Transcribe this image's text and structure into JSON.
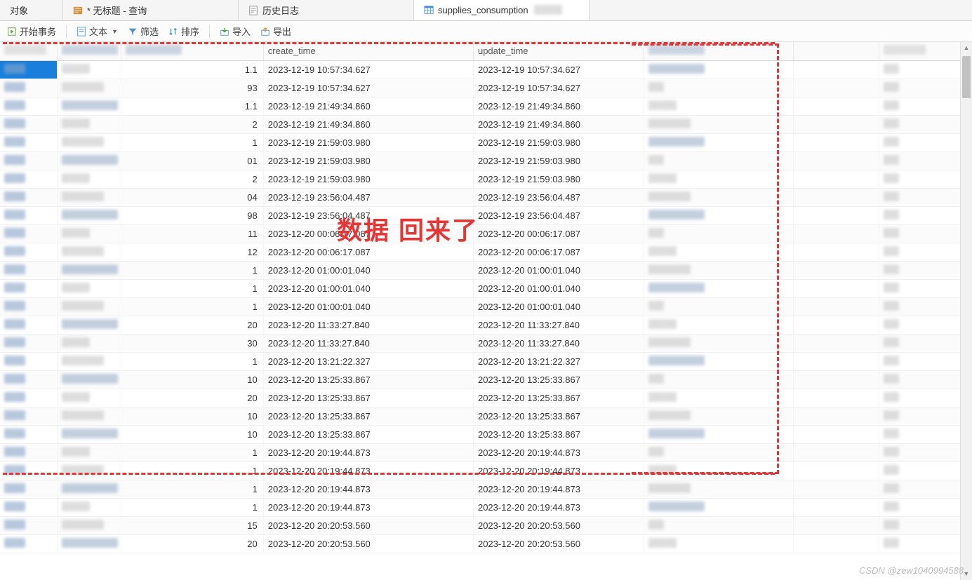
{
  "tabs": [
    {
      "label": "对象",
      "icon": "object"
    },
    {
      "label": "* 无标题 - 查询",
      "icon": "query"
    },
    {
      "label": "历史日志",
      "icon": "log"
    },
    {
      "label": "supplies_consumption",
      "icon": "table",
      "active": true
    }
  ],
  "toolbar": {
    "begin_tx": "开始事务",
    "text": "文本",
    "filter": "筛选",
    "sort": "排序",
    "import": "导入",
    "export": "导出"
  },
  "columns": {
    "c0": "",
    "c1": "",
    "c2": "",
    "create_time": "create_time",
    "update_time": "update_time",
    "c5": "",
    "c6": ""
  },
  "rows": [
    {
      "v": "1.1",
      "create": "2023-12-19 10:57:34.627",
      "update": "2023-12-19 10:57:34.627",
      "sel": true
    },
    {
      "v": "93",
      "create": "2023-12-19 10:57:34.627",
      "update": "2023-12-19 10:57:34.627"
    },
    {
      "v": "1.1",
      "create": "2023-12-19 21:49:34.860",
      "update": "2023-12-19 21:49:34.860"
    },
    {
      "v": "2",
      "create": "2023-12-19 21:49:34.860",
      "update": "2023-12-19 21:49:34.860"
    },
    {
      "v": "1",
      "create": "2023-12-19 21:59:03.980",
      "update": "2023-12-19 21:59:03.980"
    },
    {
      "v": "01",
      "create": "2023-12-19 21:59:03.980",
      "update": "2023-12-19 21:59:03.980"
    },
    {
      "v": "2",
      "create": "2023-12-19 21:59:03.980",
      "update": "2023-12-19 21:59:03.980"
    },
    {
      "v": "04",
      "create": "2023-12-19 23:56:04.487",
      "update": "2023-12-19 23:56:04.487"
    },
    {
      "v": "98",
      "create": "2023-12-19 23:56:04.487",
      "update": "2023-12-19 23:56:04.487"
    },
    {
      "v": "11",
      "create": "2023-12-20 00:06:17.087",
      "update": "2023-12-20 00:06:17.087"
    },
    {
      "v": "12",
      "create": "2023-12-20 00:06:17.087",
      "update": "2023-12-20 00:06:17.087"
    },
    {
      "v": "1",
      "create": "2023-12-20 01:00:01.040",
      "update": "2023-12-20 01:00:01.040"
    },
    {
      "v": "1",
      "create": "2023-12-20 01:00:01.040",
      "update": "2023-12-20 01:00:01.040"
    },
    {
      "v": "1",
      "create": "2023-12-20 01:00:01.040",
      "update": "2023-12-20 01:00:01.040"
    },
    {
      "v": "20",
      "create": "2023-12-20 11:33:27.840",
      "update": "2023-12-20 11:33:27.840"
    },
    {
      "v": "30",
      "create": "2023-12-20 11:33:27.840",
      "update": "2023-12-20 11:33:27.840"
    },
    {
      "v": "1",
      "create": "2023-12-20 13:21:22.327",
      "update": "2023-12-20 13:21:22.327"
    },
    {
      "v": "10",
      "create": "2023-12-20 13:25:33.867",
      "update": "2023-12-20 13:25:33.867"
    },
    {
      "v": "20",
      "create": "2023-12-20 13:25:33.867",
      "update": "2023-12-20 13:25:33.867"
    },
    {
      "v": "10",
      "create": "2023-12-20 13:25:33.867",
      "update": "2023-12-20 13:25:33.867"
    },
    {
      "v": "10",
      "create": "2023-12-20 13:25:33.867",
      "update": "2023-12-20 13:25:33.867"
    },
    {
      "v": "1",
      "create": "2023-12-20 20:19:44.873",
      "update": "2023-12-20 20:19:44.873"
    },
    {
      "v": "1",
      "create": "2023-12-20 20:19:44.873",
      "update": "2023-12-20 20:19:44.873"
    },
    {
      "v": "1",
      "create": "2023-12-20 20:19:44.873",
      "update": "2023-12-20 20:19:44.873"
    },
    {
      "v": "1",
      "create": "2023-12-20 20:19:44.873",
      "update": "2023-12-20 20:19:44.873"
    },
    {
      "v": "15",
      "create": "2023-12-20 20:20:53.560",
      "update": "2023-12-20 20:20:53.560"
    },
    {
      "v": "20",
      "create": "2023-12-20 20:20:53.560",
      "update": "2023-12-20 20:20:53.560"
    }
  ],
  "annotation": "数据 回来了",
  "watermark": "CSDN @zew1040994588"
}
